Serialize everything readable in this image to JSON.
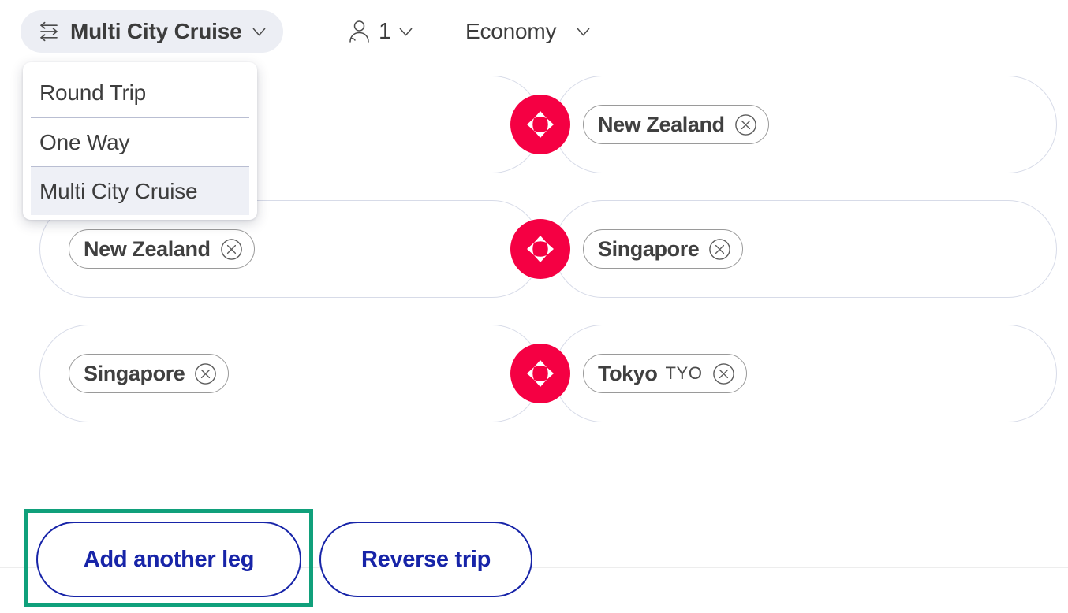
{
  "topbar": {
    "trip_type": {
      "label": "Multi City Cruise",
      "icon": "multi-city-arrows-icon",
      "caret_icon": "chevron-down-icon",
      "pill_bg": "#eceef4"
    },
    "passengers": {
      "icon": "passenger-icon",
      "count": "1",
      "caret_icon": "chevron-down-icon"
    },
    "cabin_class": {
      "label": "Economy",
      "caret_icon": "chevron-down-icon"
    }
  },
  "trip_type_dropdown": {
    "open": true,
    "selected": "Multi City Cruise",
    "highlight_color": "#eef0f6",
    "options": [
      {
        "label": "Round Trip"
      },
      {
        "label": "One Way"
      },
      {
        "label": "Multi City Cruise"
      }
    ]
  },
  "legs": [
    {
      "origin": {
        "city": "",
        "code": "",
        "placeholder": "",
        "has_tag": false
      },
      "swap_icon": "swap-arrows-icon",
      "destination": {
        "city": "New Zealand",
        "code": "",
        "has_tag": true,
        "remove_icon": "remove-circle-icon"
      }
    },
    {
      "origin": {
        "city": "New Zealand",
        "code": "",
        "has_tag": true,
        "remove_icon": "remove-circle-icon"
      },
      "swap_icon": "swap-arrows-icon",
      "destination": {
        "city": "Singapore",
        "code": "",
        "has_tag": true,
        "remove_icon": "remove-circle-icon"
      }
    },
    {
      "origin": {
        "city": "Singapore",
        "code": "",
        "has_tag": true,
        "remove_icon": "remove-circle-icon"
      },
      "swap_icon": "swap-arrows-icon",
      "destination": {
        "city": "Tokyo",
        "code": "TYO",
        "has_tag": true,
        "remove_icon": "remove-circle-icon"
      }
    }
  ],
  "actions": {
    "add_leg_label": "Add another leg",
    "reverse_trip_label": "Reverse trip",
    "highlight_color": "#10a07b",
    "button_color": "#1724a8"
  },
  "colors": {
    "swap_button": "#f50043",
    "field_border": "#d7dbe8",
    "tag_border": "#9a9a9a",
    "text": "#3c3c3c"
  }
}
